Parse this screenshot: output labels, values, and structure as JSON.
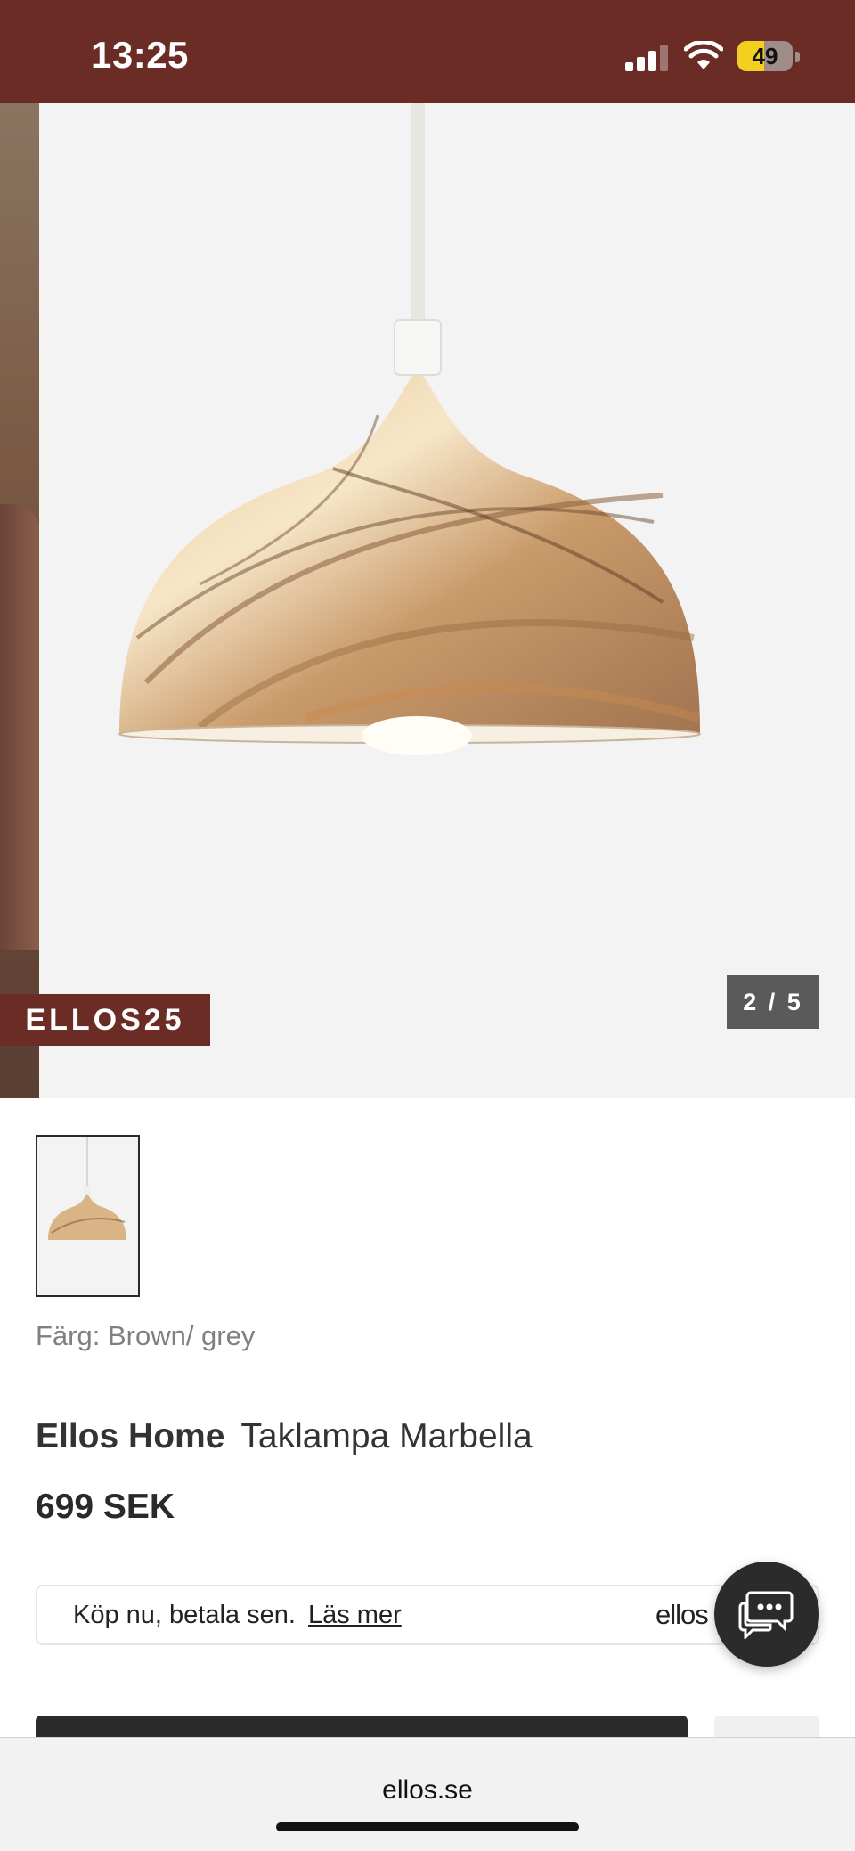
{
  "status_bar": {
    "time": "13:25",
    "battery_level": "49",
    "battery_fraction": 0.49,
    "background_color": "#6b2c25"
  },
  "gallery": {
    "promo_badge": "ELLOS25",
    "counter": "2 / 5",
    "current_image": 2,
    "total_images": 5
  },
  "product": {
    "color_label": "Färg: Brown/ grey",
    "brand": "Ellos Home",
    "name": "Taklampa Marbella",
    "price": "699 SEK"
  },
  "payment_banner": {
    "text": "Köp nu, betala sen.",
    "link": "Läs mer",
    "logo": "ellos"
  },
  "chat": {
    "icon": "chat-bubbles-icon"
  },
  "browser": {
    "url": "ellos.se"
  },
  "colors": {
    "brand_dark_red": "#6b2c25",
    "dark_button": "#2b2b2b",
    "muted_text": "#808080"
  }
}
